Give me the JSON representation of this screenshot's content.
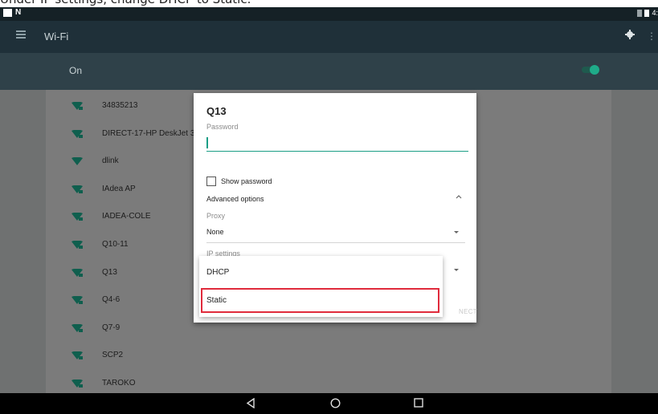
{
  "caption": "Under IP settings, change DHCP to Static.",
  "toolbar": {
    "title": "Wi-Fi"
  },
  "switchbar": {
    "label": "On"
  },
  "networks": [
    "34835213",
    "DIRECT-17-HP DeskJet 3",
    "dlink",
    "IAdea AP",
    "IADEA-COLE",
    "Q10-11",
    "Q13",
    "Q4-6",
    "Q7-9",
    "SCP2",
    "TAROKO"
  ],
  "dialog": {
    "title": "Q13",
    "password_label": "Password",
    "password_value": "",
    "show_password": "Show password",
    "advanced_options": "Advanced options",
    "proxy_label": "Proxy",
    "proxy_value": "None",
    "ip_settings_label": "IP settings",
    "connect_partial": "NECT"
  },
  "ip_menu": {
    "options": [
      "DHCP",
      "Static"
    ],
    "highlighted": "Static"
  },
  "colors": {
    "accent": "#1a9e86",
    "highlight_box": "#e02b3c",
    "toolbar": "#1f3039",
    "switchbar": "#2f4149"
  }
}
